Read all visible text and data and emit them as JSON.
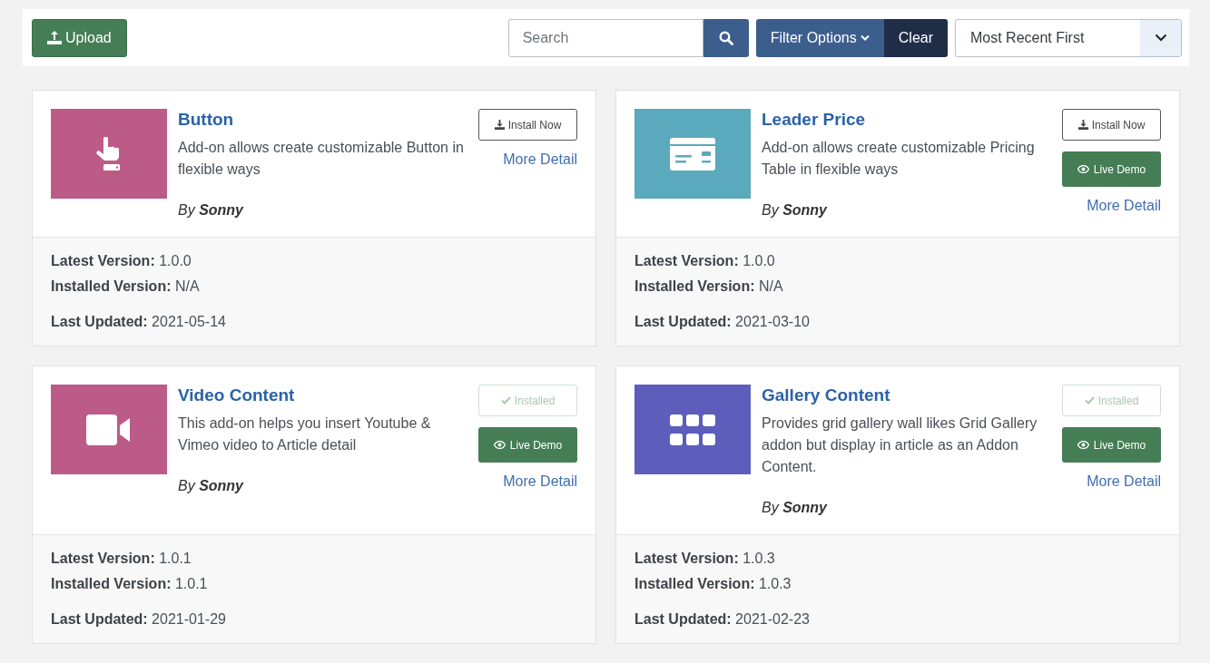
{
  "toolbar": {
    "upload_label": "Upload",
    "search": {
      "placeholder": "Search"
    },
    "filter_label": "Filter Options",
    "clear_label": "Clear",
    "sort": {
      "value": "Most Recent First"
    }
  },
  "addons": [
    {
      "title": "Button",
      "description": "Add-on allows create customizable Button in flexible ways",
      "author": "By **Sonny**",
      "thumb": {
        "kind": "hand",
        "color": "#bc5b88"
      },
      "installed": false,
      "action_label": "Install Now",
      "more_detail": "More Detail",
      "meta": [
        "**Latest Version:** 1.0.0",
        "**Installed Version:** N/A",
        "**Last Updated:** 2021-05-14"
      ]
    },
    {
      "title": "Leader Price",
      "description": "Add-on allows create customizable Pricing Table in flexible ways",
      "author": "By **Sonny**",
      "thumb": {
        "kind": "card",
        "color": "#5ba9bc"
      },
      "installed": false,
      "action_label": "Install Now",
      "live_demo": "Live Demo",
      "more_detail": "More Detail",
      "meta": [
        "**Latest Version:** 1.0.0",
        "**Installed Version:** N/A",
        "**Last Updated:** 2021-03-10"
      ]
    },
    {
      "title": "Video Content",
      "description": "This add-on helps you insert Youtube & Vimeo video to Article detail",
      "author": "By **Sonny**",
      "thumb": {
        "kind": "video",
        "color": "#bc5b88"
      },
      "installed": true,
      "action_label": "Installed",
      "live_demo": "Live Demo",
      "more_detail": "More Detail",
      "meta": [
        "**Latest Version:** 1.0.1",
        "**Installed Version:** 1.0.1",
        "**Last Updated:** 2021-01-29"
      ]
    },
    {
      "title": "Gallery Content",
      "description": "Provides grid gallery wall likes Grid Gallery addon but display in article as an Addon Content.",
      "author": "By **Sonny**",
      "thumb": {
        "kind": "grid",
        "color": "#5d5dbc"
      },
      "installed": true,
      "action_label": "Installed",
      "live_demo": "Live Demo",
      "more_detail": "More Detail",
      "meta": [
        "**Latest Version:** 1.0.3",
        "**Installed Version:** 1.0.3",
        "**Last Updated:** 2021-02-23"
      ]
    }
  ]
}
